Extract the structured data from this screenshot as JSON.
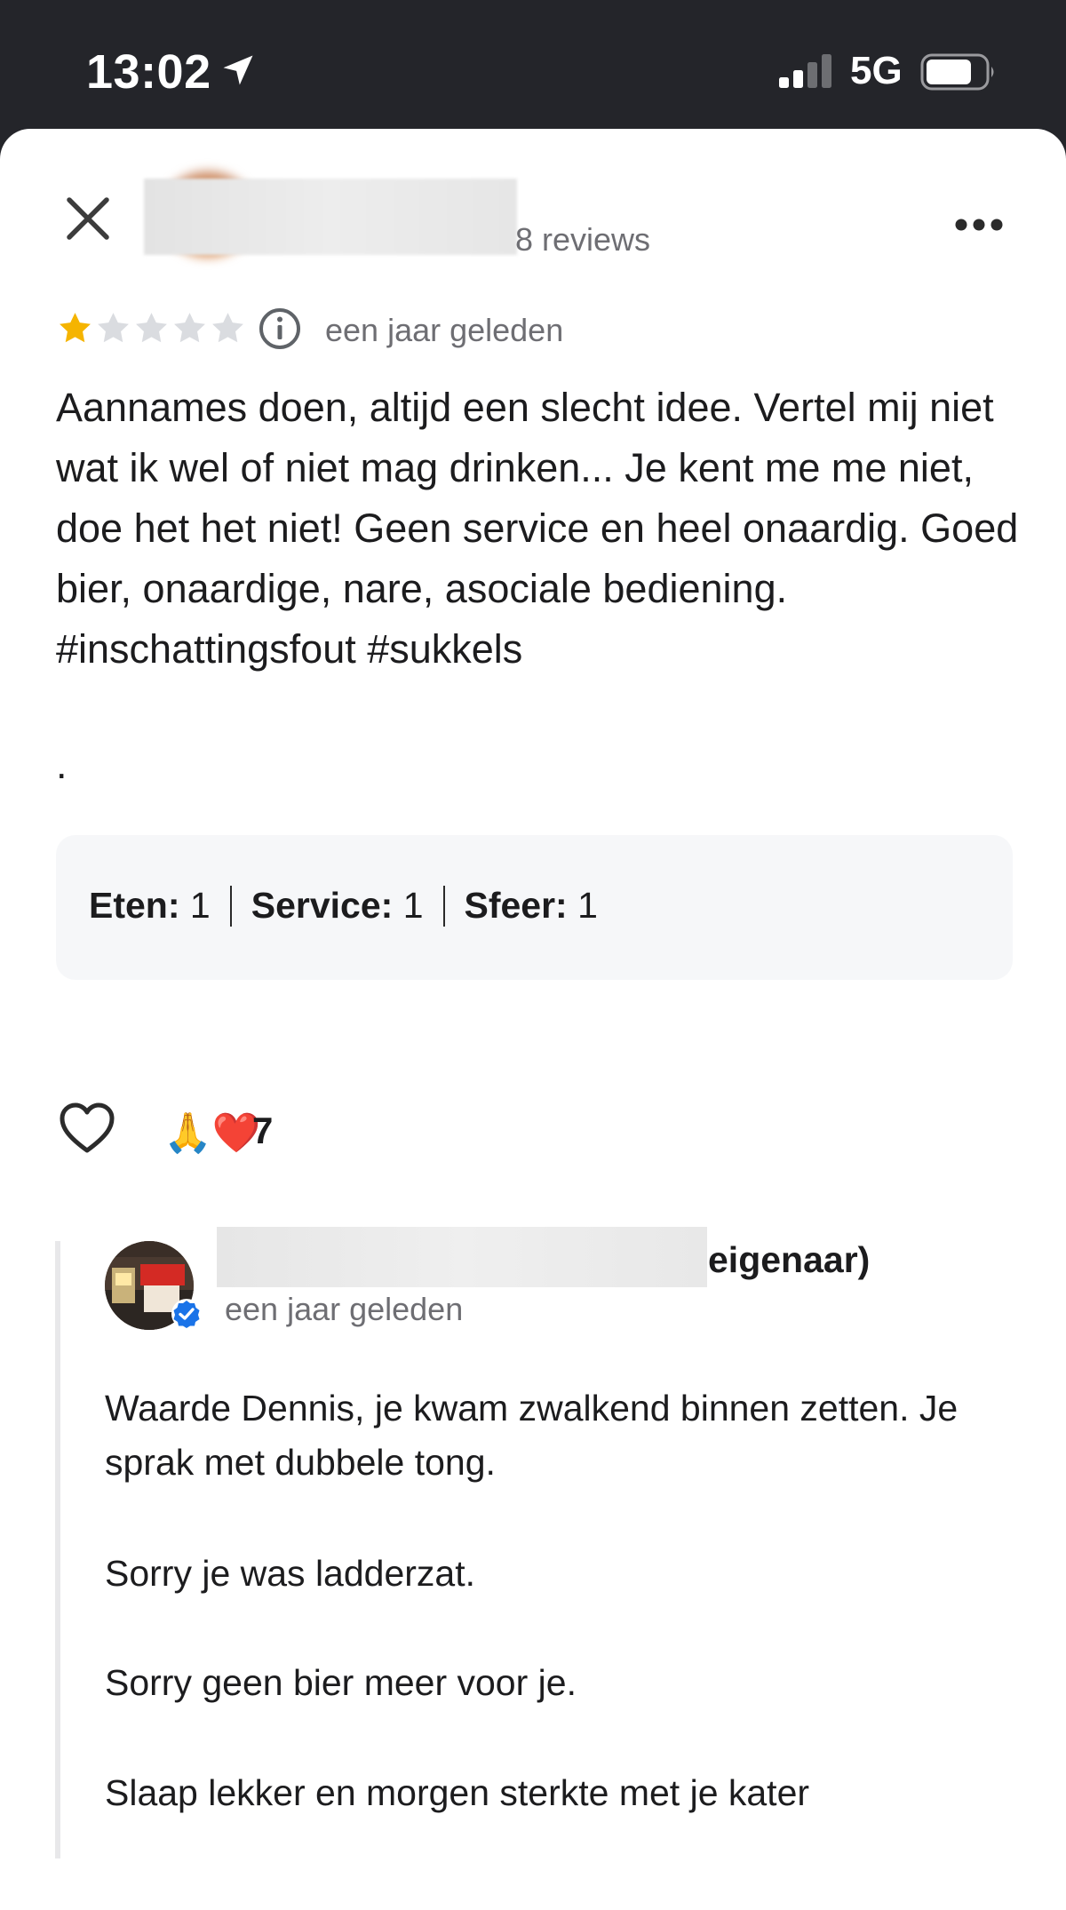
{
  "status_bar": {
    "time": "13:02",
    "network": "5G",
    "location_icon": "location-arrow-icon",
    "signal_icon": "cellular-signal-icon",
    "battery_icon": "battery-icon"
  },
  "header": {
    "close_icon": "close-icon",
    "review_count": "8 reviews",
    "more_icon": "more-options-icon"
  },
  "review": {
    "rating": 1,
    "max_rating": 5,
    "star_color": "#f5b400",
    "star_empty_color": "#dadce0",
    "date": "een jaar geleden",
    "text": "Aannames doen, altijd een slecht idee. Vertel mij niet wat ik wel of niet mag drinken... Je kent me me niet, doe het het niet! Geen service en heel onaardig. Goed bier, onaardige, nare, asociale bediening. #inschattingsfout #sukkels",
    "trailing": ".",
    "ratings": [
      {
        "label": "Eten:",
        "value": "1"
      },
      {
        "label": "Service:",
        "value": "1"
      },
      {
        "label": "Sfeer:",
        "value": "1"
      }
    ]
  },
  "reactions": {
    "like_icon": "heart-outline-icon",
    "emojis": "🙏❤️",
    "count": "7"
  },
  "owner_reply": {
    "name_suffix": "eigenaar)",
    "date": "een jaar geleden",
    "verified_color": "#1a73e8",
    "paragraphs": [
      "Waarde Dennis, je kwam zwalkend binnen zetten. Je sprak met dubbele tong.",
      "Sorry je was ladderzat.",
      "Sorry geen bier meer voor je.",
      "Slaap lekker en morgen sterkte met je kater"
    ]
  }
}
